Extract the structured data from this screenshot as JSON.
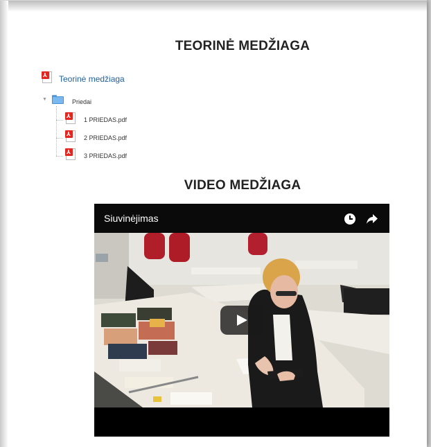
{
  "headings": {
    "theory": "TEORINĖ MEDŽIAGA",
    "video": "VIDEO MEDŽIAGA"
  },
  "theory_link": {
    "label": "Teorinė medžiaga",
    "icon": "pdf-icon"
  },
  "folder": {
    "label": "Priedai",
    "icon": "folder-icon",
    "files": [
      {
        "label": "1 PRIEDAS.pdf",
        "icon": "pdf-icon"
      },
      {
        "label": "2 PRIEDAS.pdf",
        "icon": "pdf-icon"
      },
      {
        "label": "3 PRIEDAS.pdf",
        "icon": "pdf-icon"
      }
    ]
  },
  "video": {
    "title": "Siuvinėjimas",
    "controls": [
      "clock-icon",
      "share-icon",
      "play-icon"
    ]
  },
  "colors": {
    "link": "#1f5f99",
    "pdf_badge": "#e3261f",
    "folder": "#7ab8f0",
    "video_bar": "#0a0a0a"
  }
}
